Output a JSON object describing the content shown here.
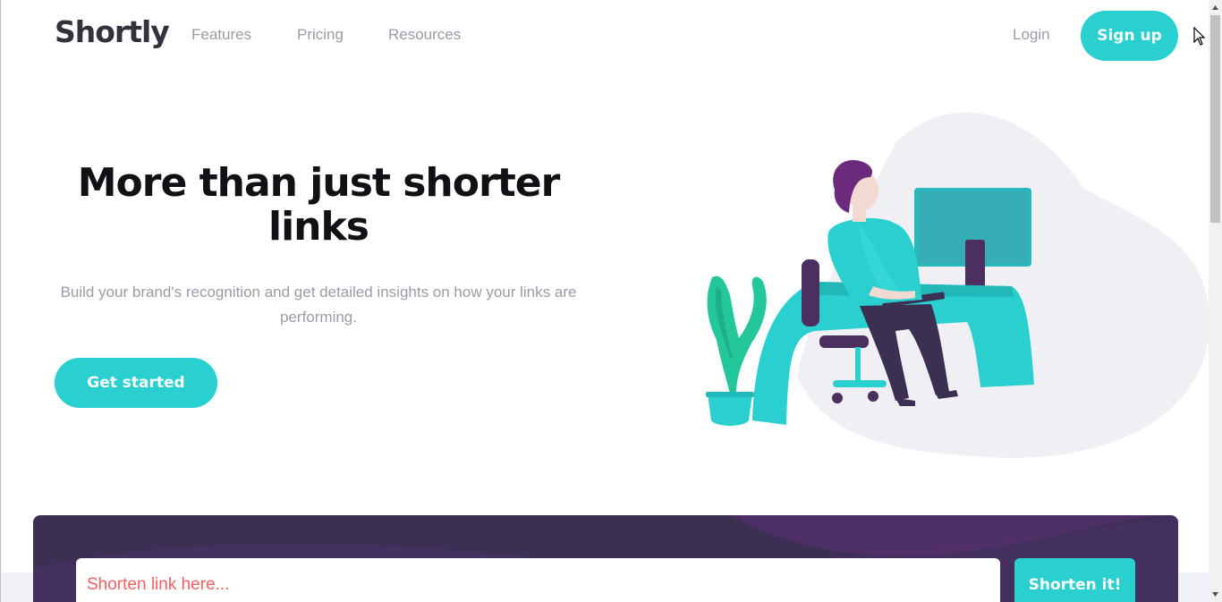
{
  "header": {
    "logo": "Shortly",
    "nav": [
      {
        "label": "Features"
      },
      {
        "label": "Pricing"
      },
      {
        "label": "Resources"
      }
    ],
    "login_label": "Login",
    "signup_label": "Sign up"
  },
  "hero": {
    "title": "More than just shorter links",
    "subtitle": "Build your brand's recognition and get detailed insights on how your links are performing.",
    "cta_label": "Get started"
  },
  "shorten": {
    "placeholder": "Shorten link here...",
    "button_label": "Shorten it!"
  },
  "colors": {
    "brand_cyan": "#2acfcf",
    "dark_violet": "#3b3054",
    "red": "#f46262",
    "gray": "#9e9aa8"
  }
}
